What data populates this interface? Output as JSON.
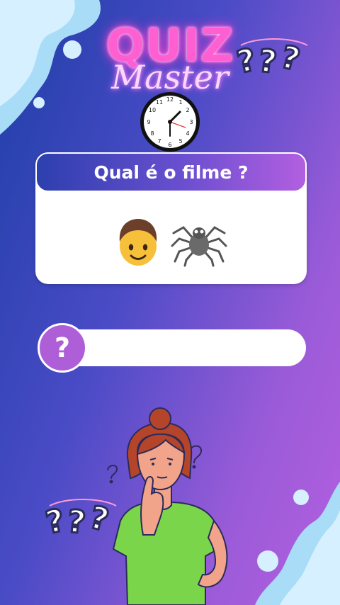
{
  "logo": {
    "line1": "QUIZ",
    "line2": "Master"
  },
  "question": {
    "title": "Qual é o filme ?",
    "emojis": [
      "man-emoji",
      "spider-emoji"
    ]
  },
  "answer": {
    "badge": "?",
    "text": ""
  },
  "decor": {
    "qmarks_top": "???",
    "qmarks_bottom": "???",
    "colors": {
      "bg_start": "#1f3fa8",
      "bg_end": "#b45fe0",
      "accent": "#ae5fd8",
      "blob": "#bfe7ff"
    }
  }
}
